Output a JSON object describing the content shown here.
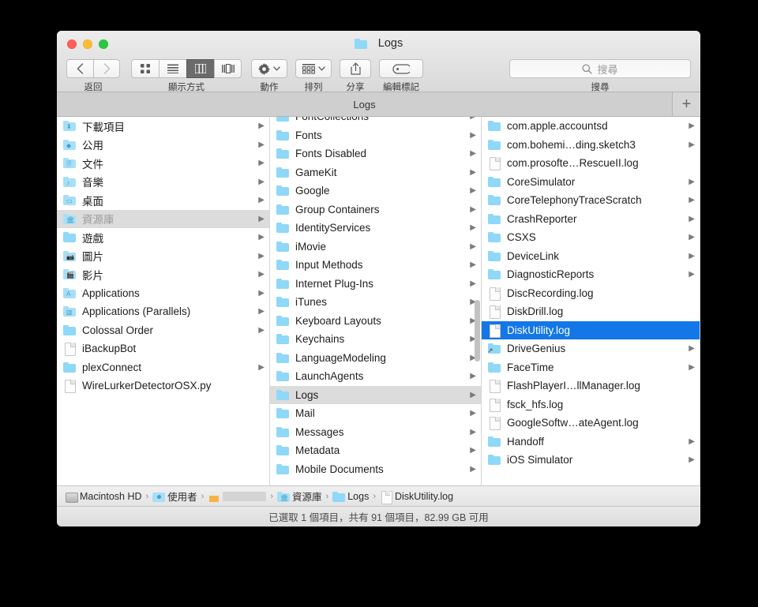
{
  "window": {
    "title": "Logs",
    "title_icon": "folder-icon",
    "traffic_lights": {
      "close": "close-button",
      "minimize": "minimize-button",
      "maximize": "maximize-button"
    }
  },
  "toolbar": {
    "nav": {
      "back_icon": "chevron-left-icon",
      "forward_icon": "chevron-right-icon",
      "label": "返回"
    },
    "view": {
      "label": "顯示方式",
      "modes": [
        {
          "name": "icon-view",
          "icon": "grid-icon",
          "active": false
        },
        {
          "name": "list-view",
          "icon": "list-icon",
          "active": false
        },
        {
          "name": "column-view",
          "icon": "columns-icon",
          "active": true
        },
        {
          "name": "gallery-view",
          "icon": "gallery-icon",
          "active": false
        }
      ]
    },
    "action": {
      "label": "動作",
      "icon": "gear-icon",
      "chevron": "chevron-down-icon"
    },
    "arrange": {
      "label": "排列",
      "icon": "arrange-grid-icon",
      "chevron": "chevron-down-icon"
    },
    "share": {
      "label": "分享",
      "icon": "share-icon"
    },
    "tags": {
      "label": "編輯標記",
      "icon": "tag-icon"
    },
    "search": {
      "label": "搜尋",
      "placeholder": "搜尋",
      "value": "",
      "icon": "search-icon"
    }
  },
  "tabbar": {
    "tabs": [
      {
        "label": "Logs",
        "active": true
      }
    ],
    "add_label": "+"
  },
  "columns": {
    "col1": {
      "name": "sidebar-column",
      "partial_top": false,
      "items": [
        {
          "label": "下載項目",
          "icon": "folder-downloads",
          "arrow": true,
          "state": "normal"
        },
        {
          "label": "公用",
          "icon": "folder-public",
          "arrow": true,
          "state": "normal"
        },
        {
          "label": "文件",
          "icon": "folder-documents",
          "arrow": true,
          "state": "normal"
        },
        {
          "label": "音樂",
          "icon": "folder-music",
          "arrow": true,
          "state": "normal"
        },
        {
          "label": "桌面",
          "icon": "folder-desktop",
          "arrow": true,
          "state": "normal"
        },
        {
          "label": "資源庫",
          "icon": "folder-library",
          "arrow": true,
          "state": "selected-inactive"
        },
        {
          "label": "遊戲",
          "icon": "folder",
          "arrow": true,
          "state": "normal"
        },
        {
          "label": "圖片",
          "icon": "folder-pictures",
          "arrow": true,
          "state": "normal"
        },
        {
          "label": "影片",
          "icon": "folder-movies",
          "arrow": true,
          "state": "normal"
        },
        {
          "label": "Applications",
          "icon": "folder-applications",
          "arrow": true,
          "state": "normal"
        },
        {
          "label": "Applications (Parallels)",
          "icon": "folder-parallels",
          "arrow": true,
          "state": "normal"
        },
        {
          "label": "Colossal Order",
          "icon": "folder",
          "arrow": true,
          "state": "normal"
        },
        {
          "label": "iBackupBot",
          "icon": "doc",
          "arrow": false,
          "state": "normal"
        },
        {
          "label": "plexConnect",
          "icon": "folder",
          "arrow": true,
          "state": "normal"
        },
        {
          "label": "WireLurkerDetectorOSX.py",
          "icon": "doc",
          "arrow": false,
          "state": "normal"
        }
      ]
    },
    "col2": {
      "name": "library-column",
      "partial_top": true,
      "items": [
        {
          "label": "FontCollections",
          "icon": "folder",
          "arrow": true,
          "state": "normal"
        },
        {
          "label": "Fonts",
          "icon": "folder",
          "arrow": true,
          "state": "normal"
        },
        {
          "label": "Fonts Disabled",
          "icon": "folder",
          "arrow": true,
          "state": "normal"
        },
        {
          "label": "GameKit",
          "icon": "folder",
          "arrow": true,
          "state": "normal"
        },
        {
          "label": "Google",
          "icon": "folder",
          "arrow": true,
          "state": "normal"
        },
        {
          "label": "Group Containers",
          "icon": "folder",
          "arrow": true,
          "state": "normal"
        },
        {
          "label": "IdentityServices",
          "icon": "folder",
          "arrow": true,
          "state": "normal"
        },
        {
          "label": "iMovie",
          "icon": "folder",
          "arrow": true,
          "state": "normal"
        },
        {
          "label": "Input Methods",
          "icon": "folder",
          "arrow": true,
          "state": "normal"
        },
        {
          "label": "Internet Plug-Ins",
          "icon": "folder",
          "arrow": true,
          "state": "normal"
        },
        {
          "label": "iTunes",
          "icon": "folder",
          "arrow": true,
          "state": "normal"
        },
        {
          "label": "Keyboard Layouts",
          "icon": "folder",
          "arrow": true,
          "state": "normal"
        },
        {
          "label": "Keychains",
          "icon": "folder",
          "arrow": true,
          "state": "normal"
        },
        {
          "label": "LanguageModeling",
          "icon": "folder",
          "arrow": true,
          "state": "normal"
        },
        {
          "label": "LaunchAgents",
          "icon": "folder",
          "arrow": true,
          "state": "normal"
        },
        {
          "label": "Logs",
          "icon": "folder",
          "arrow": true,
          "state": "selected-inactive"
        },
        {
          "label": "Mail",
          "icon": "folder",
          "arrow": true,
          "state": "normal"
        },
        {
          "label": "Messages",
          "icon": "folder",
          "arrow": true,
          "state": "normal"
        },
        {
          "label": "Metadata",
          "icon": "folder",
          "arrow": true,
          "state": "normal"
        },
        {
          "label": "Mobile Documents",
          "icon": "folder",
          "arrow": true,
          "state": "normal"
        }
      ]
    },
    "col3": {
      "name": "logs-column",
      "partial_top": false,
      "items": [
        {
          "label": "com.apple.accountsd",
          "icon": "folder",
          "arrow": true,
          "state": "normal"
        },
        {
          "label": "com.bohemi…ding.sketch3",
          "icon": "folder",
          "arrow": true,
          "state": "normal"
        },
        {
          "label": "com.prosofte…RescueII.log",
          "icon": "doc",
          "arrow": false,
          "state": "normal"
        },
        {
          "label": "CoreSimulator",
          "icon": "folder",
          "arrow": true,
          "state": "normal"
        },
        {
          "label": "CoreTelephonyTraceScratch",
          "icon": "folder",
          "arrow": true,
          "state": "normal"
        },
        {
          "label": "CrashReporter",
          "icon": "folder",
          "arrow": true,
          "state": "normal"
        },
        {
          "label": "CSXS",
          "icon": "folder",
          "arrow": true,
          "state": "normal"
        },
        {
          "label": "DeviceLink",
          "icon": "folder",
          "arrow": true,
          "state": "normal"
        },
        {
          "label": "DiagnosticReports",
          "icon": "folder",
          "arrow": true,
          "state": "normal"
        },
        {
          "label": "DiscRecording.log",
          "icon": "doc",
          "arrow": false,
          "state": "normal"
        },
        {
          "label": "DiskDrill.log",
          "icon": "doc",
          "arrow": false,
          "state": "normal"
        },
        {
          "label": "DiskUtility.log",
          "icon": "doc",
          "arrow": false,
          "state": "selected-active"
        },
        {
          "label": "DriveGenius",
          "icon": "folder-alias",
          "arrow": true,
          "state": "normal"
        },
        {
          "label": "FaceTime",
          "icon": "folder",
          "arrow": true,
          "state": "normal"
        },
        {
          "label": "FlashPlayerI…llManager.log",
          "icon": "doc",
          "arrow": false,
          "state": "normal"
        },
        {
          "label": "fsck_hfs.log",
          "icon": "doc",
          "arrow": false,
          "state": "normal"
        },
        {
          "label": "GoogleSoftw…ateAgent.log",
          "icon": "doc",
          "arrow": false,
          "state": "normal"
        },
        {
          "label": "Handoff",
          "icon": "folder",
          "arrow": true,
          "state": "normal"
        },
        {
          "label": "iOS Simulator",
          "icon": "folder",
          "arrow": true,
          "state": "normal"
        }
      ]
    }
  },
  "pathbar": {
    "crumbs": [
      {
        "label": "Macintosh HD",
        "icon": "hd-icon",
        "blank": false
      },
      {
        "label": "使用者",
        "icon": "users-icon",
        "blank": false
      },
      {
        "label": "",
        "icon": "home-icon",
        "blank": true
      },
      {
        "label": "資源庫",
        "icon": "library-icon",
        "blank": false
      },
      {
        "label": "Logs",
        "icon": "folder-icon",
        "blank": false
      },
      {
        "label": "DiskUtility.log",
        "icon": "doc-icon",
        "blank": false
      }
    ],
    "separator": "›"
  },
  "statusbar": {
    "text": "已選取 1 個項目，共有 91 個項目，82.99 GB 可用"
  },
  "colors": {
    "selection_blue": "#1477e8",
    "selection_gray": "#dcdcdc",
    "folder_blue": "#8fd8f7",
    "window_chrome": "#ececec",
    "traffic_close": "#ff5f57",
    "traffic_min": "#febc2e",
    "traffic_max": "#28c840"
  }
}
